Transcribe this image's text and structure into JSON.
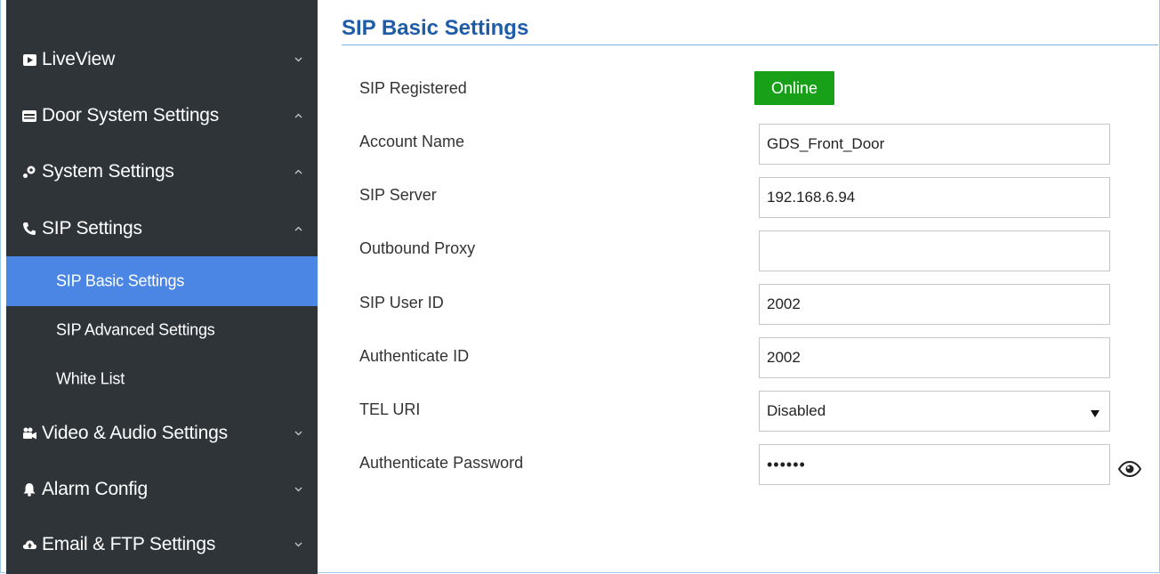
{
  "sidebar": {
    "items": [
      {
        "label": "LiveView",
        "icon": "play-box-icon",
        "chevron": "chevron-down-icon"
      },
      {
        "label": "Door System Settings",
        "icon": "card-icon",
        "chevron": "chevron-up-icon"
      },
      {
        "label": "System Settings",
        "icon": "gear-key-icon",
        "chevron": "chevron-up-icon"
      },
      {
        "label": "SIP Settings",
        "icon": "phone-icon",
        "chevron": "chevron-up-icon"
      },
      {
        "label": "Video & Audio Settings",
        "icon": "camera-icon",
        "chevron": "chevron-down-icon"
      },
      {
        "label": "Alarm Config",
        "icon": "bell-icon",
        "chevron": "chevron-down-icon"
      },
      {
        "label": "Email & FTP Settings",
        "icon": "cloud-icon",
        "chevron": "chevron-down-icon"
      }
    ],
    "sub_items": [
      {
        "label": "SIP Basic Settings",
        "active": true
      },
      {
        "label": "SIP Advanced Settings",
        "active": false
      },
      {
        "label": "White List",
        "active": false
      }
    ]
  },
  "page": {
    "title": "SIP Basic Settings"
  },
  "form": {
    "sip_registered": {
      "label": "SIP Registered",
      "status": "Online",
      "status_color": "#18a018"
    },
    "account_name": {
      "label": "Account Name",
      "value": "GDS_Front_Door"
    },
    "sip_server": {
      "label": "SIP Server",
      "value": "192.168.6.94"
    },
    "outbound_proxy": {
      "label": "Outbound Proxy",
      "value": ""
    },
    "sip_user_id": {
      "label": "SIP User ID",
      "value": "2002"
    },
    "authenticate_id": {
      "label": "Authenticate ID",
      "value": "2002"
    },
    "tel_uri": {
      "label": "TEL URI",
      "value": "Disabled"
    },
    "authenticate_password": {
      "label": "Authenticate Password",
      "value": "••••••",
      "toggle_icon": "eye-icon"
    }
  },
  "colors": {
    "sidebar_bg": "#2f3439",
    "active_item_bg": "#4c86e4",
    "title_color": "#1f5ca8"
  }
}
